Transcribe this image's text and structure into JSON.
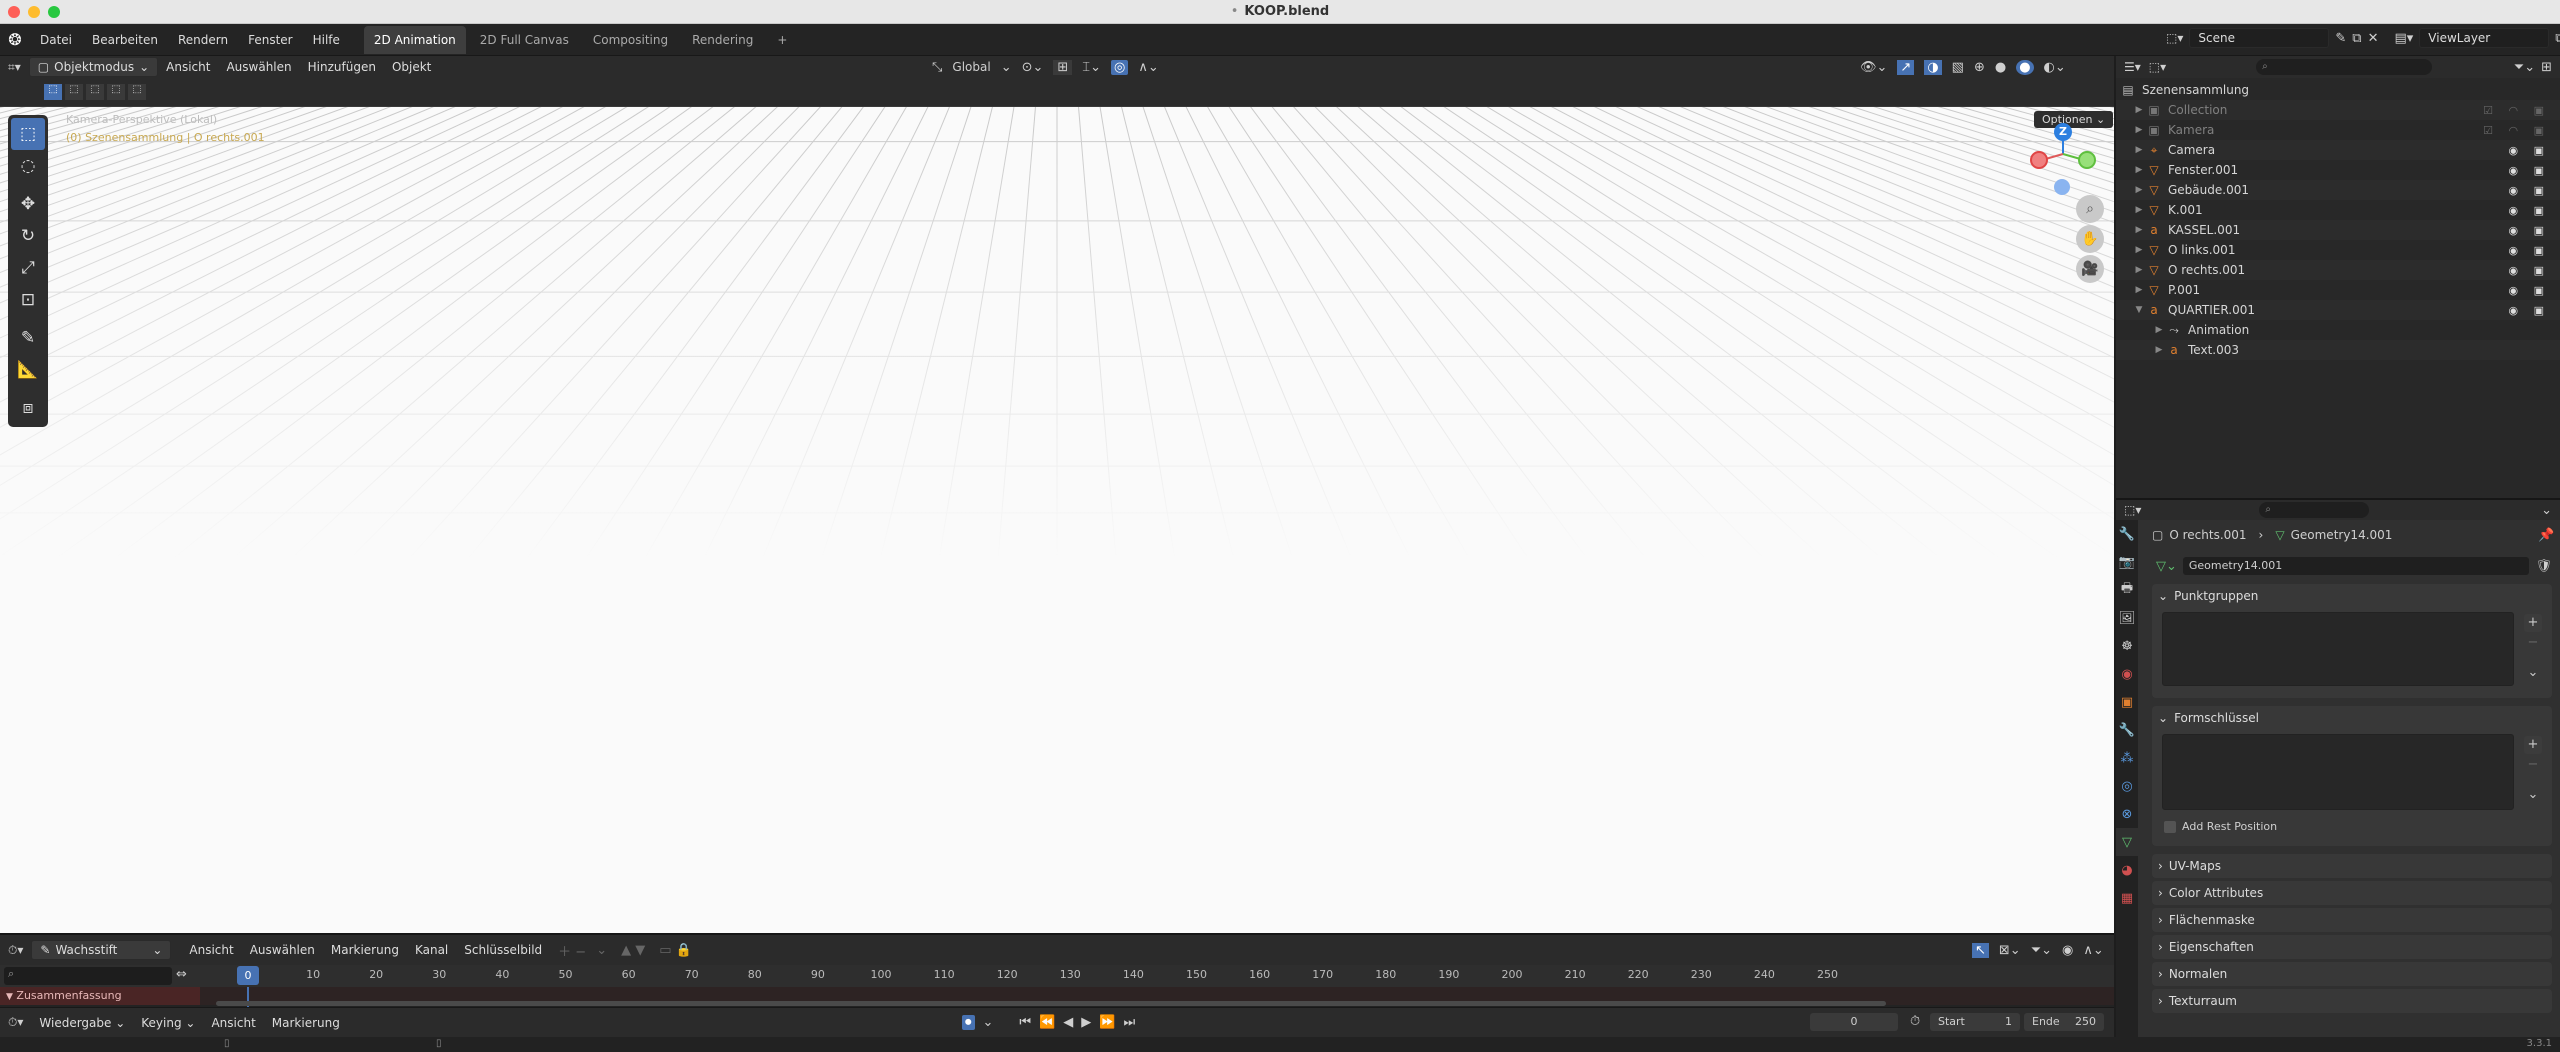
{
  "window": {
    "title": "KOOP.blend",
    "modified_dot": "•"
  },
  "menu": [
    "Datei",
    "Bearbeiten",
    "Rendern",
    "Fenster",
    "Hilfe"
  ],
  "workspaces": [
    {
      "label": "2D Animation",
      "active": true
    },
    {
      "label": "2D Full Canvas"
    },
    {
      "label": "Compositing"
    },
    {
      "label": "Rendering"
    }
  ],
  "scene": {
    "label": "Scene",
    "viewlayer": "ViewLayer"
  },
  "viewport": {
    "mode": "Objektmodus",
    "menus": [
      "Ansicht",
      "Auswählen",
      "Hinzufügen",
      "Objekt"
    ],
    "transform": "Global",
    "options": "Optionen",
    "overlay_line1": "Kamera-Perspektive (Lokal)",
    "overlay_line2": "(0) Szenensammlung | O rechts.001",
    "gizmo_z": "Z"
  },
  "timeline": {
    "brush": "Wachsstift",
    "menus": [
      "Ansicht",
      "Auswählen",
      "Markierung",
      "Kanal",
      "Schlüsselbild"
    ],
    "ticks": [
      "0",
      "10",
      "20",
      "30",
      "40",
      "50",
      "60",
      "70",
      "80",
      "90",
      "100",
      "110",
      "120",
      "130",
      "140",
      "150",
      "160",
      "170",
      "180",
      "190",
      "200",
      "210",
      "220",
      "230",
      "240",
      "250"
    ],
    "current": "0",
    "summary": "Zusammenfassung",
    "playback_menus": [
      "Wiedergabe",
      "Keying",
      "Ansicht",
      "Markierung"
    ],
    "frame": "0",
    "start_label": "Start",
    "start": "1",
    "end_label": "Ende",
    "end": "250"
  },
  "outliner": {
    "root": "Szenensammlung",
    "items": [
      {
        "label": "Collection",
        "dim": true,
        "icon": "▣"
      },
      {
        "label": "Kamera",
        "dim": true,
        "icon": "▣"
      },
      {
        "label": "Camera",
        "icon": "⌖"
      },
      {
        "label": "Fenster.001",
        "icon": "▽"
      },
      {
        "label": "Gebäude.001",
        "icon": "▽"
      },
      {
        "label": "K.001",
        "icon": "▽"
      },
      {
        "label": "KASSEL.001",
        "icon": "a"
      },
      {
        "label": "O links.001",
        "icon": "▽"
      },
      {
        "label": "O rechts.001",
        "icon": "▽"
      },
      {
        "label": "P.001",
        "icon": "▽"
      },
      {
        "label": "QUARTIER.001",
        "icon": "a"
      },
      {
        "label": "Animation",
        "icon": "⤳",
        "child": true
      },
      {
        "label": "Text.003",
        "icon": "a",
        "child": true
      }
    ]
  },
  "properties": {
    "breadcrumb_object": "O rechts.001",
    "breadcrumb_data": "Geometry14.001",
    "datablock": "Geometry14.001",
    "panels": {
      "punktgruppen": "Punktgruppen",
      "formschluessel": "Formschlüssel",
      "add_rest": "Add Rest Position",
      "uvmaps": "UV-Maps",
      "color_attr": "Color Attributes",
      "flaechenmaske": "Flächenmaske",
      "eigenschaften": "Eigenschaften",
      "normalen": "Normalen",
      "texturraum": "Texturraum"
    }
  },
  "status": {
    "version": "3.3.1"
  },
  "colors": {
    "accent": "#4772b3",
    "viewport_bg": "#fafafa",
    "ui_bg": "#303030"
  }
}
